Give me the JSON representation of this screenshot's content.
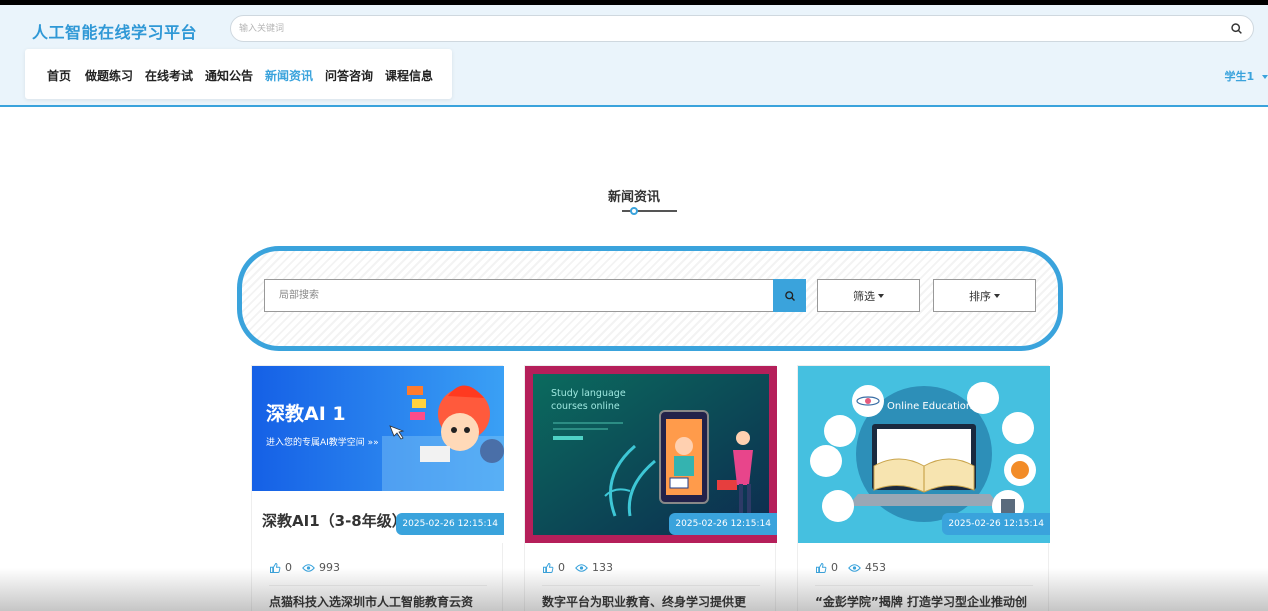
{
  "header": {
    "logo": "人工智能在线学习平台",
    "search_placeholder": "输入关键词"
  },
  "nav": {
    "items": [
      {
        "label": "首页"
      },
      {
        "label": "做题练习"
      },
      {
        "label": "在线考试"
      },
      {
        "label": "通知公告"
      },
      {
        "label": "新闻资讯",
        "active": true
      },
      {
        "label": "问答咨询"
      },
      {
        "label": "课程信息"
      }
    ],
    "user": "学生1"
  },
  "section": {
    "title": "新闻资讯"
  },
  "filter": {
    "search_placeholder": "局部搜索",
    "filter_label": "筛选",
    "sort_label": "排序"
  },
  "colors": {
    "accent": "#3aa3dc"
  },
  "cards": [
    {
      "image_heading": "深教AI 1",
      "image_subheading": "进入您的专属AI教学空间 »»",
      "image_caption": "深教AI1（3-8年级）",
      "date": "2025-02-26 12:15:14",
      "likes": "0",
      "views": "993",
      "title": "点猫科技入选深圳市人工智能教育云资"
    },
    {
      "image_heading": "Study language",
      "image_subheading": "courses online",
      "date": "2025-02-26 12:15:14",
      "likes": "0",
      "views": "133",
      "title": "数字平台为职业教育、终身学习提供更"
    },
    {
      "image_heading": "Online Education",
      "date": "2025-02-26 12:15:14",
      "likes": "0",
      "views": "453",
      "title": "“金彭学院”揭牌 打造学习型企业推动创"
    }
  ]
}
